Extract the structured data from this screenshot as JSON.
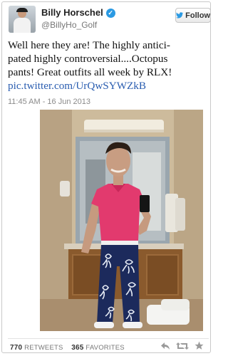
{
  "tweet": {
    "author_name": "Billy Horschel",
    "handle": "@BillyHo_Golf",
    "follow_label": "Follow",
    "text_lines": [
      "Well here they are! The highly antici-",
      "pated highly  controversial....Octopus",
      "pants! Great outfits all week by RLX!"
    ],
    "link_text": "pic.twitter.com/UrQwSYWZkB",
    "timestamp": "11:45 AM - 16 Jun 2013",
    "retweets_count": "770",
    "retweets_label": "RETWEETS",
    "favorites_count": "365",
    "favorites_label": "FAVORITES"
  },
  "colors": {
    "link": "#2a5db0",
    "verified": "#2b9ae3",
    "shirt": "#e23a6e",
    "pants": "#1c2a5c"
  },
  "icons": {
    "verified": "verified-badge-icon",
    "follow": "twitter-bird-icon",
    "reply": "reply-icon",
    "retweet": "retweet-icon",
    "favorite": "star-icon"
  }
}
